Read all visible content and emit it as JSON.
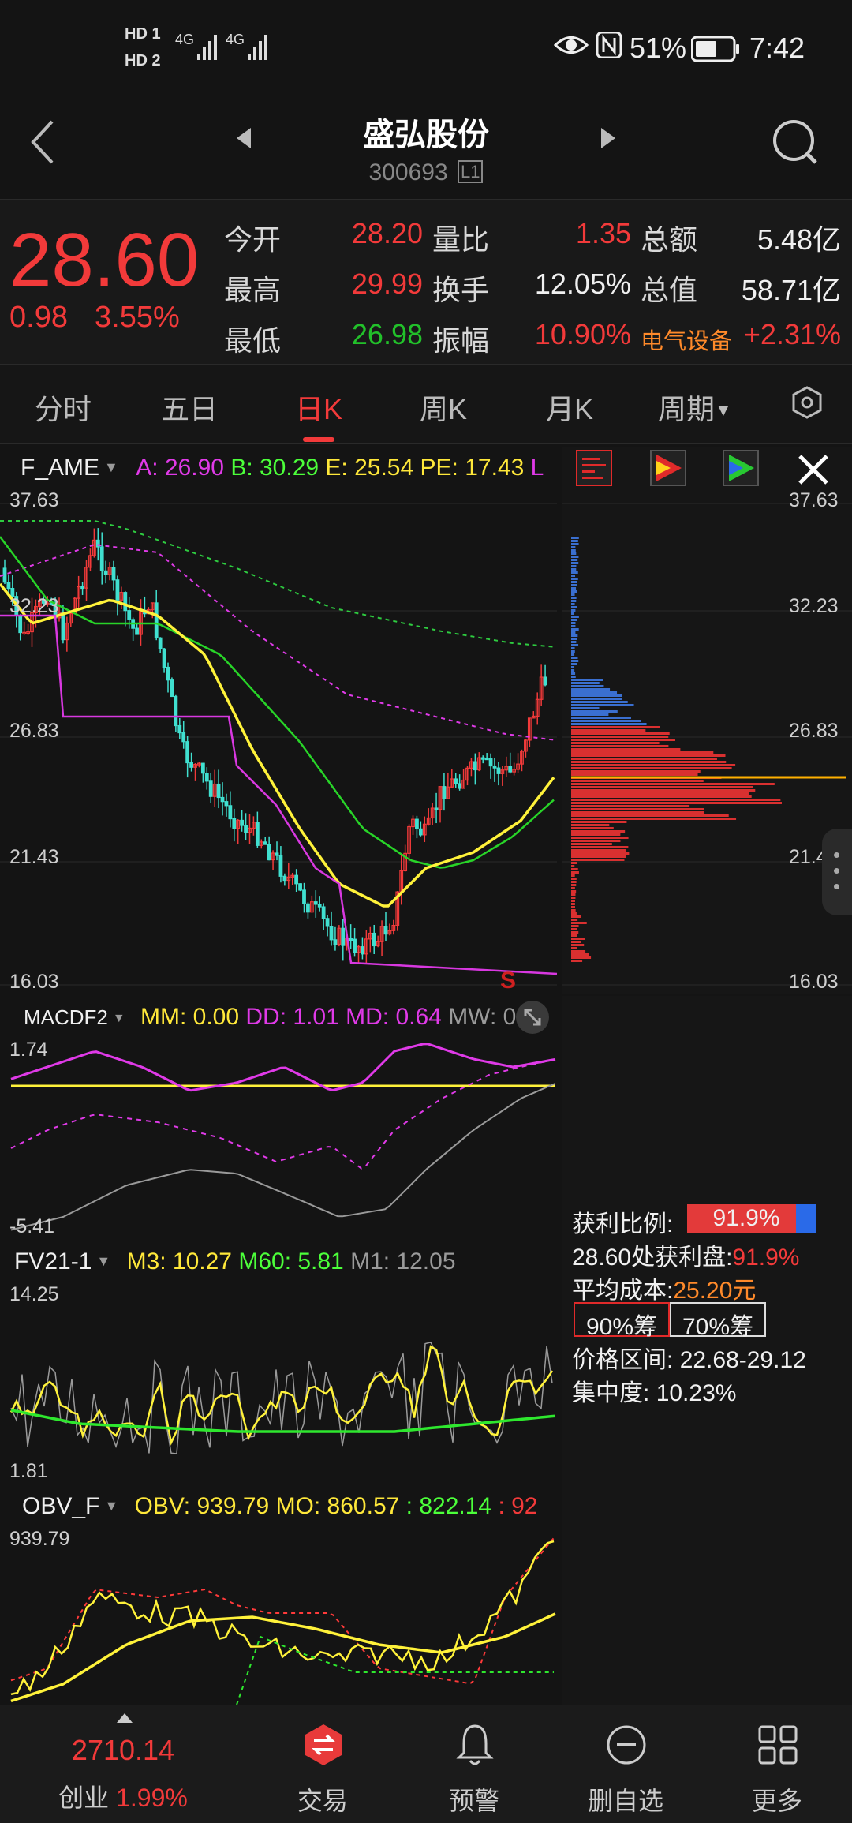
{
  "status_bar": {
    "hd1": "HD 1",
    "hd2": "HD 2",
    "sig1": "4G",
    "sig2": "4G",
    "battery": "51%",
    "time": "7:42"
  },
  "header": {
    "title": "盛弘股份",
    "code": "300693",
    "level_badge": "L1"
  },
  "quote": {
    "price": "28.60",
    "change": "0.98",
    "change_pct": "3.55%",
    "rows": [
      {
        "l1": "今开",
        "v1": "28.20",
        "l2": "量比",
        "v2": "1.35",
        "l3": "总额",
        "v3": "5.48亿"
      },
      {
        "l1": "最高",
        "v1": "29.99",
        "l2": "换手",
        "v2": "12.05%",
        "l3": "总值",
        "v3": "58.71亿"
      },
      {
        "l1": "最低",
        "v1": "26.98",
        "l2": "振幅",
        "v2": "10.90%",
        "l3": "电气设备",
        "v3": "+2.31%"
      }
    ],
    "colors": {
      "up": "#f23a3a",
      "down": "#22c12a"
    }
  },
  "tabs": [
    {
      "label": "分时"
    },
    {
      "label": "五日"
    },
    {
      "label": "日K",
      "active": true
    },
    {
      "label": "周K"
    },
    {
      "label": "月K"
    },
    {
      "label": "周期"
    }
  ],
  "main_chart": {
    "indicator": "F_AME",
    "a": "A: 26.90",
    "b": "B: 30.29",
    "e": "E: 25.54",
    "pe": "PE: 17.43",
    "l": "L",
    "y_labels": [
      "37.63",
      "32.23",
      "26.83",
      "21.43",
      "16.03"
    ],
    "signal": "S"
  },
  "macd": {
    "name": "MACDF2",
    "mm": "MM: 0.00",
    "dd": "DD: 1.01",
    "md": "MD: 0.64",
    "mw": "MW: 0.2",
    "y_top": "1.74",
    "y_bottom": "-5.41"
  },
  "fv": {
    "name": "FV21-1",
    "m3": "M3: 10.27",
    "m60": "M60: 5.81",
    "m1": "M1: 12.05",
    "y_top": "14.25",
    "y_bottom": "1.81"
  },
  "obv": {
    "name": "OBV_F",
    "obv": "OBV: 939.79",
    "mo": "MO: 860.57",
    "v3": ": 822.14",
    "v4": ": 92",
    "y_top": "939.79"
  },
  "chip": {
    "profit_label": "获利比例:",
    "profit_value": "91.9%",
    "profit_fraction": 0.919,
    "at_price_label": "28.60处获利盘:",
    "at_price_value": "91.9%",
    "avg_cost_label": "平均成本:",
    "avg_cost_value": "25.20元",
    "btn90": "90%筹",
    "btn70": "70%筹",
    "range_label": "价格区间:",
    "range_value": "22.68-29.12",
    "conc_label": "集中度:",
    "conc_value": "10.23%"
  },
  "bottom_nav": {
    "index_value": "2710.14",
    "index_name": "创业",
    "index_pct": "1.99%",
    "items": [
      "交易",
      "预警",
      "删自选",
      "更多"
    ]
  }
}
